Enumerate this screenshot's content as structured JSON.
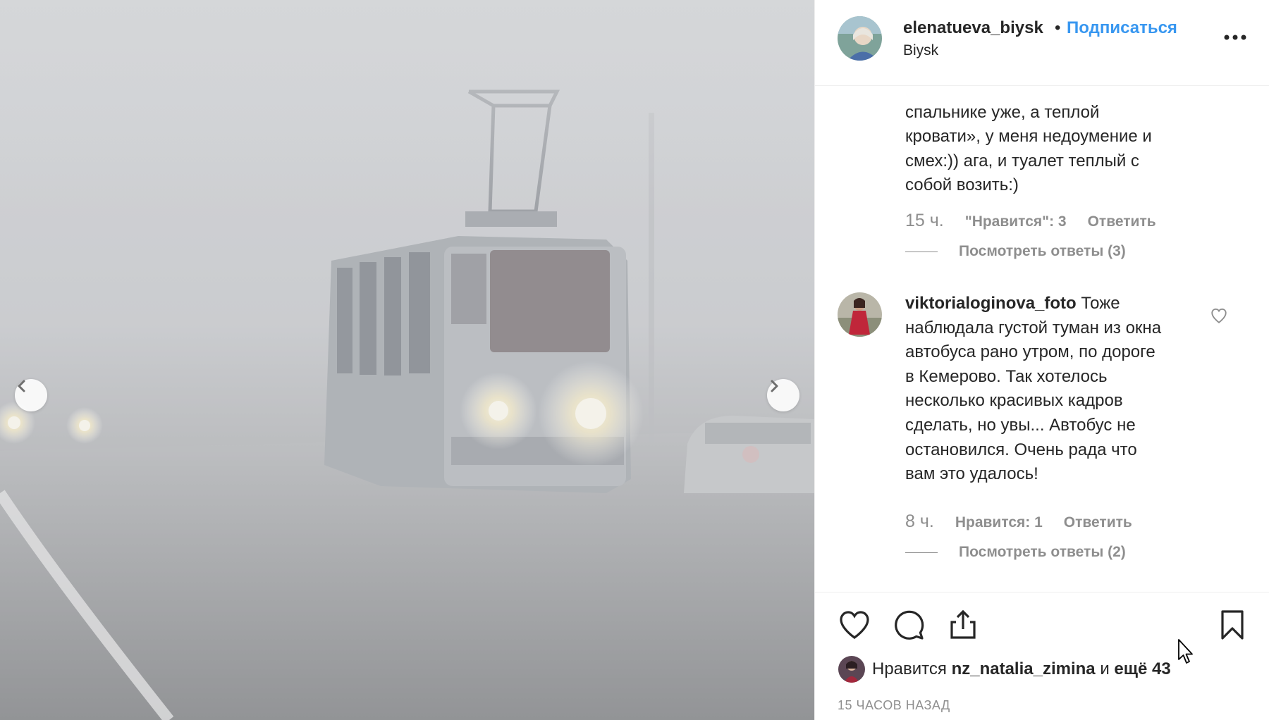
{
  "post": {
    "photo_alt": "",
    "prev_icon": "chevron-left-icon",
    "next_icon": "chevron-right-icon"
  },
  "header": {
    "username": "elenatueva_biysk",
    "separator": "•",
    "follow_label": "Подписаться",
    "location": "Biysk",
    "more_label": "..."
  },
  "comments": [
    {
      "text_lines": [
        "спальнике уже, а теплой",
        "кровати», у меня недоумение и",
        "смех:)) ага, и туалет теплый с",
        "собой возить:)"
      ],
      "time": "15 ч.",
      "likes": "\"Нравится\": 3",
      "reply": "Ответить",
      "view_replies": "Посмотреть ответы (3)"
    },
    {
      "username": "viktorialoginova_foto",
      "text_first": "Тоже",
      "text_lines": [
        "наблюдала густой туман из окна",
        "автобуса рано утром, по дороге",
        "в Кемерово. Так хотелось",
        "несколько красивых кадров",
        "сделать, но увы... Автобус не",
        "остановился. Очень рада что",
        "вам это удалось!"
      ],
      "time": "8 ч.",
      "likes": "Нравится: 1",
      "reply": "Ответить",
      "view_replies": "Посмотреть ответы (2)"
    }
  ],
  "actions": {
    "like_icon": "heart-icon",
    "comment_icon": "comment-icon",
    "share_icon": "share-icon",
    "save_icon": "bookmark-icon"
  },
  "likes_summary": {
    "prefix": "Нравится",
    "user": "nz_natalia_zimina",
    "middle": "и",
    "suffix": "ещё 43"
  },
  "time_ago": "15 ЧАСОВ НАЗАД",
  "colors": {
    "link": "#3897f0",
    "muted": "#8e8e8e",
    "text": "#262626"
  }
}
